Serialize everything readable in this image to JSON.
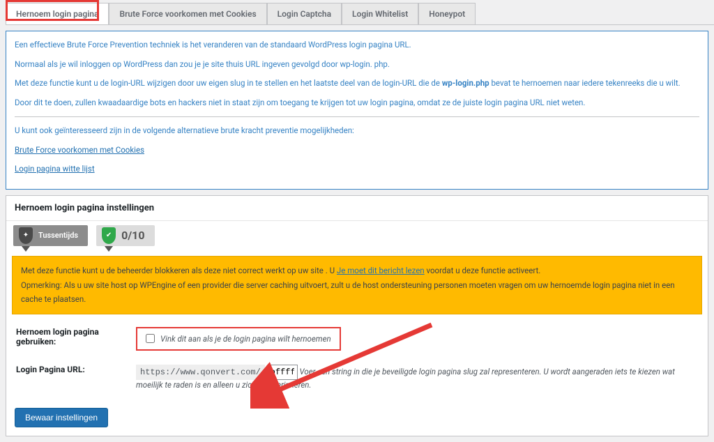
{
  "tabs": {
    "items": [
      "Hernoem login pagina",
      "Brute Force voorkomen met Cookies",
      "Login Captcha",
      "Login Whitelist",
      "Honeypot"
    ]
  },
  "info": {
    "p1_a": "Een effectieve Brute Force Prevention techniek is het veranderen van de standaard WordPress login pagina URL.",
    "p2": "Normaal als je wil inloggen op WordPress dan zou je je site thuis URL ingeven gevolgd door wp-login. php.",
    "p3_a": "Met deze functie kunt u de login-URL wijzigen door uw eigen slug in te stellen en het laatste deel van de login-URL die de ",
    "p3_b": "wp-login.php",
    "p3_c": " bevat te hernoemen naar iedere tekenreeks die u wilt.",
    "p4": "Door dit te doen, zullen kwaadaardige bots en hackers niet in staat zijn om toegang te krijgen tot uw login pagina, omdat ze de juiste login pagina URL niet weten.",
    "p5": "U kunt ook geïnteresseerd zijn in de volgende alternatieve brute kracht preventie mogelijkheden:",
    "link1": "Brute Force voorkomen met Cookies",
    "link2": "Login pagina witte lijst"
  },
  "section_heading": "Hernoem login pagina instellingen",
  "badges": {
    "b1_label": "Tussentijds",
    "b2_score": "0/10"
  },
  "warning": {
    "line1_a": "Met deze functie kunt u de beheerder blokkeren als deze niet correct werkt op uw site . U ",
    "line1_link": "Je moet dit bericht lezen",
    "line1_b": " voordat u deze functie activeert.",
    "line2": "Opmerking: Als u uw site host op WPEngine of een provider die server caching uitvoert, zult u de host ondersteuning personen moeten vragen om uw hernoemde login pagina niet in een cache te plaatsen."
  },
  "form": {
    "row1_label": "Hernoem login pagina gebruiken:",
    "row1_check": "Vink dit aan als je de login pagina wilt hernoemen",
    "row2_label": "Login Pagina URL:",
    "row2_url": "https://www.qonvert.com/",
    "row2_input": "pffff",
    "row2_hint": "Voer een string in die je beveiligde login pagina slug zal representeren. U wordt aangeraden iets te kiezen wat moeilijk te raden is en alleen u zich zult herinneren."
  },
  "save_btn": "Bewaar instellingen"
}
